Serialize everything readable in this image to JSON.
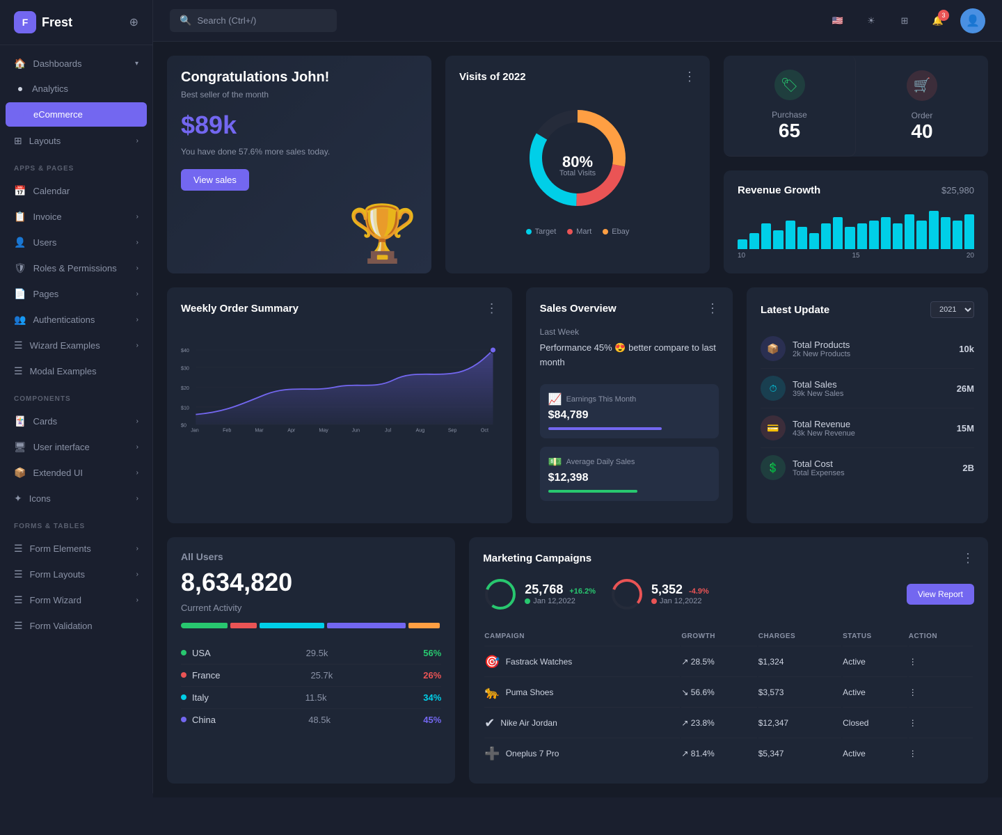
{
  "app": {
    "name": "Frest"
  },
  "topbar": {
    "search_placeholder": "Search (Ctrl+/)",
    "notification_count": "3"
  },
  "sidebar": {
    "sections": [
      {
        "items": [
          {
            "id": "dashboards",
            "label": "Dashboards",
            "icon": "🏠",
            "has_arrow": true,
            "active": false,
            "dot": false
          },
          {
            "id": "analytics",
            "label": "Analytics",
            "icon": "•",
            "has_arrow": false,
            "active": false,
            "dot": true
          },
          {
            "id": "ecommerce",
            "label": "eCommerce",
            "icon": "•",
            "has_arrow": false,
            "active": true,
            "dot": true
          }
        ]
      },
      {
        "label": "APPS & PAGES",
        "items": [
          {
            "id": "layouts",
            "label": "Layouts",
            "icon": "⊞",
            "has_arrow": true,
            "active": false
          },
          {
            "id": "calendar",
            "label": "Calendar",
            "icon": "📅",
            "has_arrow": false,
            "active": false
          },
          {
            "id": "invoice",
            "label": "Invoice",
            "icon": "📋",
            "has_arrow": true,
            "active": false
          },
          {
            "id": "users",
            "label": "Users",
            "icon": "👤",
            "has_arrow": true,
            "active": false
          },
          {
            "id": "roles",
            "label": "Roles & Permissions",
            "icon": "🛡",
            "has_arrow": true,
            "active": false
          },
          {
            "id": "pages",
            "label": "Pages",
            "icon": "📄",
            "has_arrow": true,
            "active": false
          },
          {
            "id": "auth",
            "label": "Authentications",
            "icon": "👥",
            "has_arrow": true,
            "active": false
          },
          {
            "id": "wizard",
            "label": "Wizard Examples",
            "icon": "☰",
            "has_arrow": true,
            "active": false
          },
          {
            "id": "modal",
            "label": "Modal Examples",
            "icon": "☰",
            "has_arrow": false,
            "active": false
          }
        ]
      },
      {
        "label": "COMPONENTS",
        "items": [
          {
            "id": "cards",
            "label": "Cards",
            "icon": "🃏",
            "has_arrow": true,
            "active": false
          },
          {
            "id": "ui",
            "label": "User interface",
            "icon": "🖥",
            "has_arrow": true,
            "active": false
          },
          {
            "id": "extended",
            "label": "Extended UI",
            "icon": "📦",
            "has_arrow": true,
            "active": false
          },
          {
            "id": "icons",
            "label": "Icons",
            "icon": "✦",
            "has_arrow": true,
            "active": false
          }
        ]
      },
      {
        "label": "FORMS & TABLES",
        "items": [
          {
            "id": "form-elements",
            "label": "Form Elements",
            "icon": "☰",
            "has_arrow": true,
            "active": false
          },
          {
            "id": "form-layouts",
            "label": "Form Layouts",
            "icon": "☰",
            "has_arrow": true,
            "active": false
          },
          {
            "id": "form-wizard",
            "label": "Form Wizard",
            "icon": "☰",
            "has_arrow": true,
            "active": false
          },
          {
            "id": "form-validation",
            "label": "Form Validation",
            "icon": "☰",
            "has_arrow": false,
            "active": false
          }
        ]
      }
    ]
  },
  "congrats": {
    "title": "Congratulations John!",
    "subtitle": "Best seller of the month",
    "amount": "$89k",
    "description": "You have done 57.6% more sales today.",
    "button": "View sales"
  },
  "visits": {
    "title": "Visits of 2022",
    "percentage": "80%",
    "label": "Total Visits",
    "legend": [
      {
        "label": "Target",
        "color": "#00cfe8"
      },
      {
        "label": "Mart",
        "color": "#ea5455"
      },
      {
        "label": "Ebay",
        "color": "#ff9f43"
      }
    ]
  },
  "purchase_stat": {
    "label": "Purchase",
    "value": "65",
    "icon": "🏷",
    "icon_bg": "#28c76f"
  },
  "order_stat": {
    "label": "Order",
    "value": "40",
    "icon": "🛒",
    "icon_bg": "#ea5455"
  },
  "revenue": {
    "title": "Revenue Growth",
    "amount": "$25,980",
    "bars": [
      3,
      5,
      8,
      6,
      9,
      7,
      5,
      8,
      10,
      7,
      8,
      9,
      10,
      8,
      11,
      9,
      12,
      10,
      9,
      11
    ],
    "labels": [
      "10",
      "15",
      "20"
    ]
  },
  "weekly_order": {
    "title": "Weekly Order Summary",
    "x_labels": [
      "Jan",
      "Feb",
      "Mar",
      "Apr",
      "May",
      "Jun",
      "Jul",
      "Aug",
      "Sep",
      "Oct"
    ],
    "y_labels": [
      "$40",
      "$30",
      "$20",
      "$10",
      "$0"
    ]
  },
  "sales_overview": {
    "title": "Sales Overview",
    "last_week": "Last Week",
    "performance": "Performance 45% 😍 better compare to last month",
    "earnings": {
      "label": "Earnings This Month",
      "value": "$84,789",
      "bar_color": "#7367f0",
      "bar_width": "70%"
    },
    "daily_sales": {
      "label": "Average Daily Sales",
      "value": "$12,398",
      "bar_color": "#28c76f",
      "bar_width": "55%"
    }
  },
  "latest_update": {
    "title": "Latest Update",
    "year": "2021",
    "items": [
      {
        "name": "Total Products",
        "sub": "2k New Products",
        "value": "10k",
        "color": "#7367f0"
      },
      {
        "name": "Total Sales",
        "sub": "39k New Sales",
        "value": "26M",
        "color": "#00cfe8"
      },
      {
        "name": "Total Revenue",
        "sub": "43k New Revenue",
        "value": "15M",
        "color": "#ea5455"
      },
      {
        "name": "Total Cost",
        "sub": "Total Expenses",
        "value": "2B",
        "color": "#28c76f"
      }
    ]
  },
  "all_users": {
    "title": "All Users",
    "count": "8,634,820",
    "activity_label": "Current Activity",
    "bars": [
      {
        "color": "#28c76f",
        "width": "18%"
      },
      {
        "color": "#ea5455",
        "width": "10%"
      },
      {
        "color": "#00cfe8",
        "width": "25%"
      },
      {
        "color": "#7367f0",
        "width": "30%"
      },
      {
        "color": "#ff9f43",
        "width": "12%"
      }
    ],
    "users": [
      {
        "country": "USA",
        "count": "29.5k",
        "percent": "56%",
        "color": "#28c76f"
      },
      {
        "country": "France",
        "count": "25.7k",
        "percent": "26%",
        "color": "#ea5455"
      },
      {
        "country": "Italy",
        "count": "11.5k",
        "percent": "34%",
        "color": "#00cfe8"
      },
      {
        "country": "China",
        "count": "48.5k",
        "percent": "45%",
        "color": "#7367f0"
      }
    ]
  },
  "marketing": {
    "title": "Marketing Campaigns",
    "stat1": {
      "value": "25,768",
      "change": "+16.2%",
      "change_color": "#28c76f",
      "date": "Jan 12,2022"
    },
    "stat2": {
      "value": "5,352",
      "change": "-4.9%",
      "change_color": "#ea5455",
      "date": "Jan 12,2022"
    },
    "view_report": "View Report",
    "columns": [
      "CAMPAIGN",
      "GROWTH",
      "CHARGES",
      "STATUS",
      "ACTION"
    ],
    "campaigns": [
      {
        "name": "Fastrack Watches",
        "icon": "🎯",
        "icon_color": "#ea5455",
        "growth": "28.5%",
        "growth_up": true,
        "charges": "$1,324",
        "status": "Active"
      },
      {
        "name": "Puma Shoes",
        "icon": "🐆",
        "icon_color": "#333",
        "growth": "56.6%",
        "growth_up": false,
        "charges": "$3,573",
        "status": "Active"
      },
      {
        "name": "Nike Air Jordan",
        "icon": "✔",
        "icon_color": "#333",
        "growth": "23.8%",
        "growth_up": true,
        "charges": "$12,347",
        "status": "Closed"
      },
      {
        "name": "Oneplus 7 Pro",
        "icon": "➕",
        "icon_color": "#ea5455",
        "growth": "81.4%",
        "growth_up": true,
        "charges": "$5,347",
        "status": "Active"
      }
    ]
  }
}
